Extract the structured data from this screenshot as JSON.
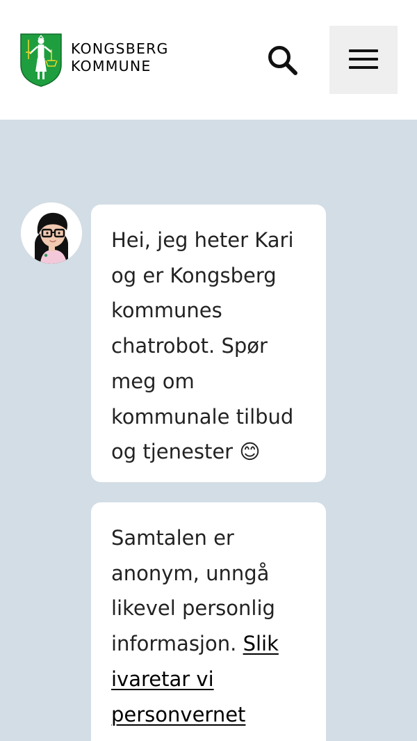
{
  "header": {
    "brand_line1": "KONGSBERG",
    "brand_line2": "KOMMUNE",
    "logo_icon": "kongsberg-coat-of-arms",
    "search_icon": "search-icon",
    "menu_icon": "hamburger-menu-icon"
  },
  "chat": {
    "bot_avatar_icon": "kari-chatbot-avatar",
    "messages": [
      {
        "text": "Hei, jeg heter Kari og er Kongsberg kommunes chatrobot. Spør meg om kommunale tilbud og tjenester 😊"
      },
      {
        "text": "Samtalen er anonym, unngå likevel personlig informasjon. ",
        "link_text": "Slik ivaretar vi personvernet"
      }
    ]
  },
  "colors": {
    "chat_background": "#d3dde5",
    "logo_green": "#1f9e3f",
    "logo_gold": "#e8d62c",
    "menu_button_bg": "#efefef"
  }
}
